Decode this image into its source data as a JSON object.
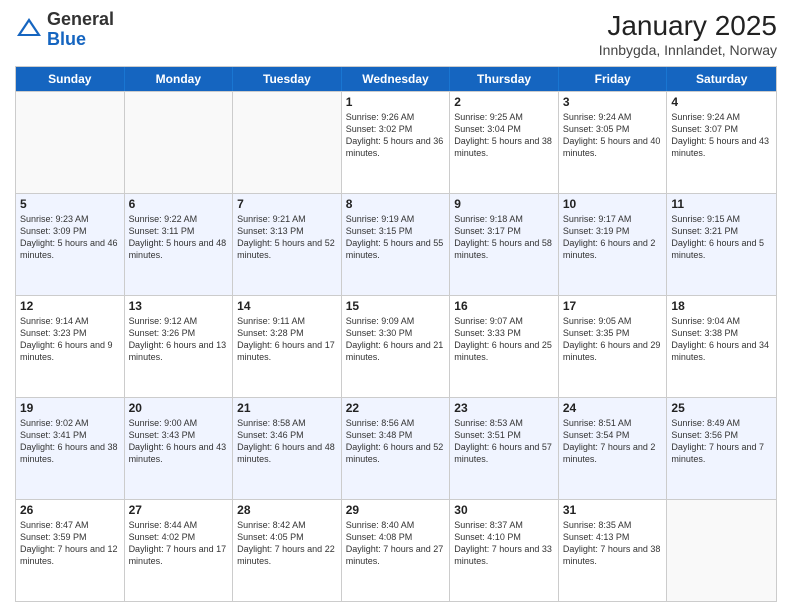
{
  "logo": {
    "general": "General",
    "blue": "Blue"
  },
  "header": {
    "month": "January 2025",
    "location": "Innbygda, Innlandet, Norway"
  },
  "weekdays": [
    "Sunday",
    "Monday",
    "Tuesday",
    "Wednesday",
    "Thursday",
    "Friday",
    "Saturday"
  ],
  "rows": [
    [
      {
        "day": "",
        "info": ""
      },
      {
        "day": "",
        "info": ""
      },
      {
        "day": "",
        "info": ""
      },
      {
        "day": "1",
        "info": "Sunrise: 9:26 AM\nSunset: 3:02 PM\nDaylight: 5 hours and 36 minutes."
      },
      {
        "day": "2",
        "info": "Sunrise: 9:25 AM\nSunset: 3:04 PM\nDaylight: 5 hours and 38 minutes."
      },
      {
        "day": "3",
        "info": "Sunrise: 9:24 AM\nSunset: 3:05 PM\nDaylight: 5 hours and 40 minutes."
      },
      {
        "day": "4",
        "info": "Sunrise: 9:24 AM\nSunset: 3:07 PM\nDaylight: 5 hours and 43 minutes."
      }
    ],
    [
      {
        "day": "5",
        "info": "Sunrise: 9:23 AM\nSunset: 3:09 PM\nDaylight: 5 hours and 46 minutes."
      },
      {
        "day": "6",
        "info": "Sunrise: 9:22 AM\nSunset: 3:11 PM\nDaylight: 5 hours and 48 minutes."
      },
      {
        "day": "7",
        "info": "Sunrise: 9:21 AM\nSunset: 3:13 PM\nDaylight: 5 hours and 52 minutes."
      },
      {
        "day": "8",
        "info": "Sunrise: 9:19 AM\nSunset: 3:15 PM\nDaylight: 5 hours and 55 minutes."
      },
      {
        "day": "9",
        "info": "Sunrise: 9:18 AM\nSunset: 3:17 PM\nDaylight: 5 hours and 58 minutes."
      },
      {
        "day": "10",
        "info": "Sunrise: 9:17 AM\nSunset: 3:19 PM\nDaylight: 6 hours and 2 minutes."
      },
      {
        "day": "11",
        "info": "Sunrise: 9:15 AM\nSunset: 3:21 PM\nDaylight: 6 hours and 5 minutes."
      }
    ],
    [
      {
        "day": "12",
        "info": "Sunrise: 9:14 AM\nSunset: 3:23 PM\nDaylight: 6 hours and 9 minutes."
      },
      {
        "day": "13",
        "info": "Sunrise: 9:12 AM\nSunset: 3:26 PM\nDaylight: 6 hours and 13 minutes."
      },
      {
        "day": "14",
        "info": "Sunrise: 9:11 AM\nSunset: 3:28 PM\nDaylight: 6 hours and 17 minutes."
      },
      {
        "day": "15",
        "info": "Sunrise: 9:09 AM\nSunset: 3:30 PM\nDaylight: 6 hours and 21 minutes."
      },
      {
        "day": "16",
        "info": "Sunrise: 9:07 AM\nSunset: 3:33 PM\nDaylight: 6 hours and 25 minutes."
      },
      {
        "day": "17",
        "info": "Sunrise: 9:05 AM\nSunset: 3:35 PM\nDaylight: 6 hours and 29 minutes."
      },
      {
        "day": "18",
        "info": "Sunrise: 9:04 AM\nSunset: 3:38 PM\nDaylight: 6 hours and 34 minutes."
      }
    ],
    [
      {
        "day": "19",
        "info": "Sunrise: 9:02 AM\nSunset: 3:41 PM\nDaylight: 6 hours and 38 minutes."
      },
      {
        "day": "20",
        "info": "Sunrise: 9:00 AM\nSunset: 3:43 PM\nDaylight: 6 hours and 43 minutes."
      },
      {
        "day": "21",
        "info": "Sunrise: 8:58 AM\nSunset: 3:46 PM\nDaylight: 6 hours and 48 minutes."
      },
      {
        "day": "22",
        "info": "Sunrise: 8:56 AM\nSunset: 3:48 PM\nDaylight: 6 hours and 52 minutes."
      },
      {
        "day": "23",
        "info": "Sunrise: 8:53 AM\nSunset: 3:51 PM\nDaylight: 6 hours and 57 minutes."
      },
      {
        "day": "24",
        "info": "Sunrise: 8:51 AM\nSunset: 3:54 PM\nDaylight: 7 hours and 2 minutes."
      },
      {
        "day": "25",
        "info": "Sunrise: 8:49 AM\nSunset: 3:56 PM\nDaylight: 7 hours and 7 minutes."
      }
    ],
    [
      {
        "day": "26",
        "info": "Sunrise: 8:47 AM\nSunset: 3:59 PM\nDaylight: 7 hours and 12 minutes."
      },
      {
        "day": "27",
        "info": "Sunrise: 8:44 AM\nSunset: 4:02 PM\nDaylight: 7 hours and 17 minutes."
      },
      {
        "day": "28",
        "info": "Sunrise: 8:42 AM\nSunset: 4:05 PM\nDaylight: 7 hours and 22 minutes."
      },
      {
        "day": "29",
        "info": "Sunrise: 8:40 AM\nSunset: 4:08 PM\nDaylight: 7 hours and 27 minutes."
      },
      {
        "day": "30",
        "info": "Sunrise: 8:37 AM\nSunset: 4:10 PM\nDaylight: 7 hours and 33 minutes."
      },
      {
        "day": "31",
        "info": "Sunrise: 8:35 AM\nSunset: 4:13 PM\nDaylight: 7 hours and 38 minutes."
      },
      {
        "day": "",
        "info": ""
      }
    ]
  ]
}
